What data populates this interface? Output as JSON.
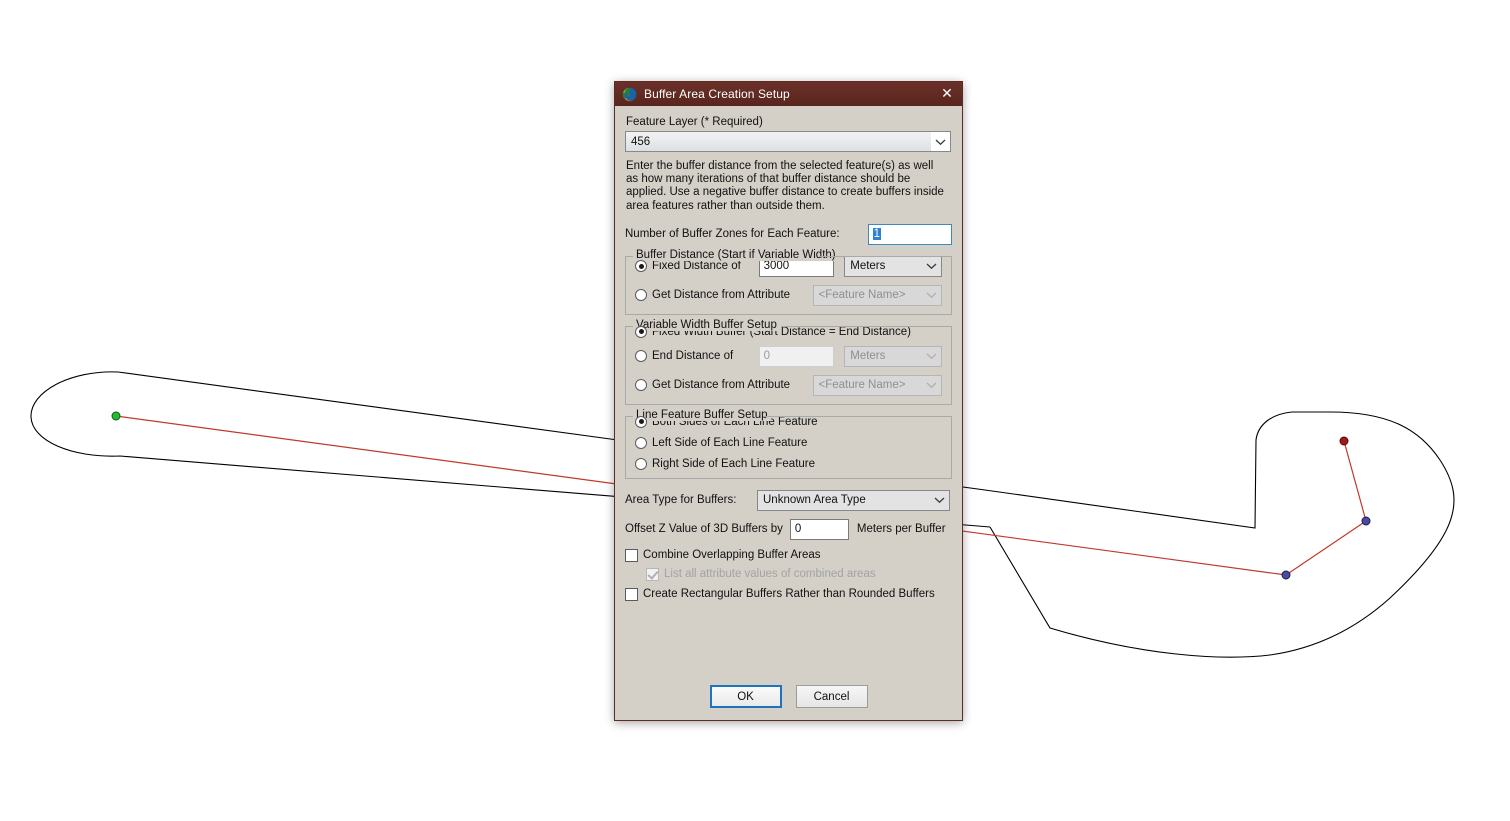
{
  "window": {
    "title": "Buffer Area Creation Setup",
    "icon": "globe-spiral-icon",
    "close_label": "✕",
    "titlebar_color": "#5f2b22"
  },
  "form": {
    "feature_layer_label": "Feature Layer (* Required)",
    "feature_layer_value": "456",
    "description": "Enter the buffer distance from the selected feature(s) as well as how many iterations of that buffer distance should be applied. Use a negative buffer distance to create buffers inside area features rather than outside them.",
    "zones_label": "Number of Buffer Zones for Each Feature:",
    "zones_value": "1"
  },
  "buffer_distance": {
    "group_title": "Buffer Distance (Start if Variable Width)",
    "fixed_label": "Fixed Distance of",
    "fixed_value": "3000",
    "fixed_units": "Meters",
    "attribute_label": "Get Distance from Attribute",
    "attribute_value": "<Feature Name>"
  },
  "variable_width": {
    "group_title": "Variable Width Buffer Setup",
    "fixed_width_label": "Fixed Width Buffer (Start Distance = End Distance)",
    "end_distance_label": "End Distance of",
    "end_distance_value": "0",
    "end_distance_units": "Meters",
    "attribute_label": "Get Distance from Attribute",
    "attribute_value": "<Feature Name>"
  },
  "line_feature": {
    "group_title": "Line Feature Buffer Setup",
    "options": [
      "Both Sides of Each Line Feature",
      "Left Side of Each Line Feature",
      "Right Side of Each Line Feature"
    ]
  },
  "options": {
    "area_type_label": "Area Type for Buffers:",
    "area_type_value": "Unknown Area Type",
    "offset_label": "Offset Z Value of 3D Buffers by",
    "offset_value": "0",
    "offset_suffix": "Meters per Buffer",
    "combine_label": "Combine Overlapping Buffer Areas",
    "list_attributes_label": "List all attribute values of combined areas",
    "rectangular_label": "Create Rectangular Buffers Rather than Rounded Buffers"
  },
  "buttons": {
    "ok": "OK",
    "cancel": "Cancel"
  },
  "map": {
    "line_color": "#c0392b",
    "buffer_color": "#000000",
    "start_vertex_color": "#22bb33",
    "mid_vertex_color": "#3b3b9e",
    "end_vertex_color": "#a01818"
  }
}
